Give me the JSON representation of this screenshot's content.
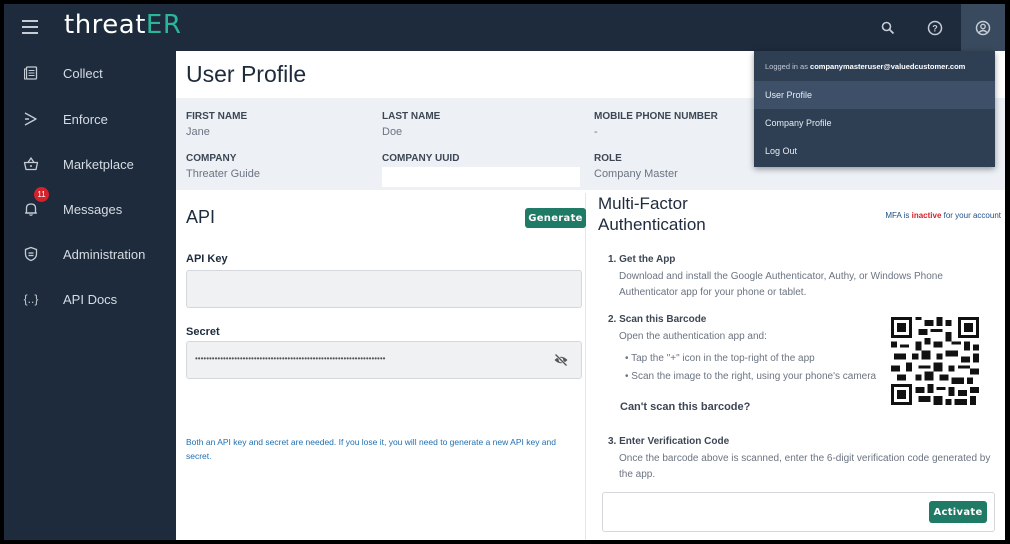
{
  "app": {
    "logo_main": "threat",
    "logo_accent": "ER"
  },
  "topbar": {
    "icons": [
      "menu-icon",
      "search-icon",
      "help-icon",
      "user-account-icon"
    ]
  },
  "sidebar": {
    "items": [
      {
        "label": "Collect",
        "icon": "document-stack-icon"
      },
      {
        "label": "Enforce",
        "icon": "route-icon"
      },
      {
        "label": "Marketplace",
        "icon": "basket-icon"
      },
      {
        "label": "Messages",
        "icon": "bell-icon",
        "badge": "11"
      },
      {
        "label": "Administration",
        "icon": "shield-icon"
      },
      {
        "label": "API Docs",
        "icon": "code-braces-icon",
        "icon_text": "{..}"
      }
    ]
  },
  "page": {
    "title": "User Profile"
  },
  "profile": {
    "first_name_label": "FIRST NAME",
    "first_name": "Jane",
    "last_name_label": "LAST NAME",
    "last_name": "Doe",
    "mobile_label": "MOBILE PHONE NUMBER",
    "mobile": "-",
    "company_label": "COMPANY",
    "company": "Threater Guide",
    "uuid_label": "COMPANY UUID",
    "uuid": "",
    "role_label": "ROLE",
    "role": "Company Master"
  },
  "api": {
    "title": "API",
    "generate_label": "Generate",
    "key_label": "API Key",
    "key_value": "",
    "secret_label": "Secret",
    "secret_mask": "••••••••••••••••••••••••••••••••••••••••••••••••••••••••••••••••••••",
    "note": "Both an API key and secret are needed. If you lose it, you will need to generate a new API key and secret."
  },
  "mfa": {
    "title": "Multi-Factor Authentication",
    "status_prefix": "MFA is",
    "status_value": "inactive",
    "status_suffix": "for your account",
    "step1_title": "1. Get the App",
    "step1_text": "Download and install the Google Authenticator, Authy, or Windows Phone Authenticator app for your phone or tablet.",
    "step2_title": "2. Scan this Barcode",
    "step2_intro": "Open the authentication app and:",
    "step2_bullets": [
      "Tap the \"+\" icon in the top-right of the app",
      "Scan the image to the right, using your phone's camera"
    ],
    "cant_scan": "Can't scan this barcode?",
    "step3_title": "3. Enter Verification Code",
    "step3_text": "Once the barcode above is scanned, enter the 6-digit verification code generated by the app.",
    "code_value": "",
    "activate_label": "Activate"
  },
  "user_menu": {
    "logged_in_prefix": "Logged in as",
    "email": "companymasteruser@valuedcustomer.com",
    "items": [
      "User Profile",
      "Company Profile",
      "Log Out"
    ]
  },
  "colors": {
    "nav_bg": "#1e2b3c",
    "accent_green": "#1f7a66",
    "logo_accent": "#2bb59a",
    "inactive_red": "#d6202a",
    "link_blue": "#1f6fb2"
  }
}
